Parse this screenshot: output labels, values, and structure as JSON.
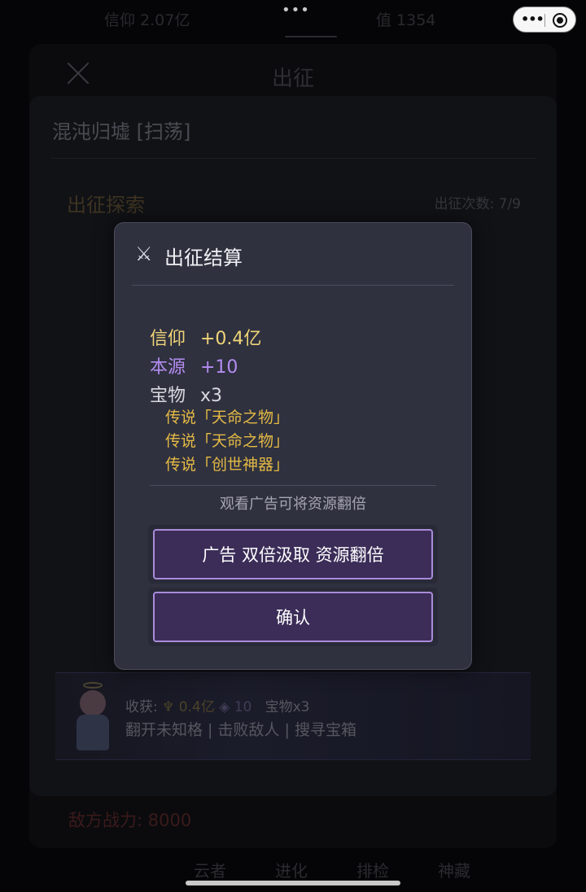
{
  "status_bar": {
    "left_resource": "信仰 2.07亿",
    "right_resource": "值 1354",
    "dots": "•••"
  },
  "miniprogram_capsule": {
    "more_icon": "more-dots-icon",
    "close_icon": "target-circle-icon"
  },
  "header": {
    "title": "出征",
    "close_icon": "close-icon"
  },
  "stage": {
    "title": "混沌归墟 [扫荡]",
    "section_title": "出征探索",
    "count_label": "出征次数: 7/9"
  },
  "modal": {
    "title": "出征结算",
    "icon": "crossed-swords-icon",
    "rewards": {
      "faith": {
        "label": "信仰",
        "value": "+0.4亿"
      },
      "origin": {
        "label": "本源",
        "value": "+10"
      },
      "treasure": {
        "label": "宝物",
        "value": "x3"
      }
    },
    "treasure_items": [
      "传说「天命之物」",
      "传说「天命之物」",
      "传说「创世神器」"
    ],
    "ad_hint": "观看广告可将资源翻倍",
    "ad_button_label": "广告 双倍汲取  资源翻倍",
    "confirm_button_label": "确认"
  },
  "log": {
    "harvest_label": "收获:",
    "harvest_faith": "0.4亿",
    "harvest_origin": "10",
    "harvest_treasure": "宝物x3",
    "actions": "翻开未知格 | 击败敌人 | 搜寻宝箱"
  },
  "enemy_power": "敌方战力: 8000",
  "bottom_tabs": [
    "云者",
    "进化",
    "排检",
    "神藏"
  ],
  "colors": {
    "faith_gold": "#f0d478",
    "origin_purple": "#b38cf0",
    "legend_gold": "#e5ba45",
    "button_border": "#a98cd9",
    "button_fill": "#3b2d58"
  }
}
